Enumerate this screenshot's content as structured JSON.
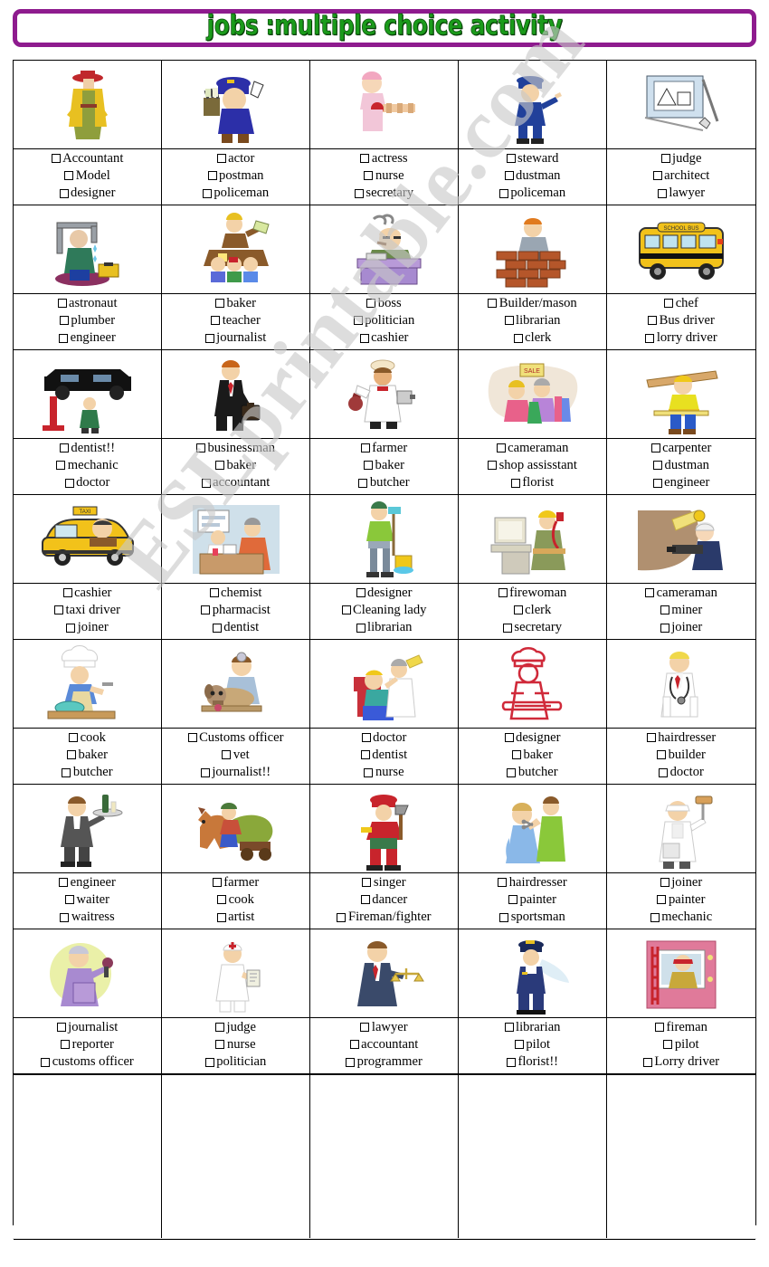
{
  "header": {
    "title": "jobs :multiple choice activity",
    "title_color": "#1b9b1b",
    "border_color": "#8e1b8e"
  },
  "watermark": {
    "text": "ESLprintable.com",
    "color": "#c9c9c9"
  },
  "grid": {
    "columns": 5,
    "rows": 8,
    "checkbox_glyph": "checkbox-empty",
    "cells": [
      {
        "image": "woman-model-yellow-coat-red-hat",
        "options": [
          "Accountant",
          "Model",
          "designer"
        ]
      },
      {
        "image": "postman-blue-uniform-mailbag",
        "options": [
          "actor",
          "postman",
          "policeman"
        ]
      },
      {
        "image": "nurse-pink-cap-with-bandaged-leg",
        "options": [
          "actress",
          "nurse",
          "secretary"
        ]
      },
      {
        "image": "policeman-blue-uniform-pointing",
        "options": [
          "steward",
          "dustman",
          "policeman"
        ]
      },
      {
        "image": "architect-drawing-board-blueprint",
        "options": [
          "judge",
          "architect",
          "lawyer"
        ]
      },
      {
        "image": "plumber-fixing-leaking-pipe-toolbox",
        "options": [
          "astronaut",
          "plumber",
          "engineer"
        ]
      },
      {
        "image": "teacher-with-children-at-desk",
        "options": [
          "baker",
          "teacher",
          "journalist"
        ]
      },
      {
        "image": "boss-at-desk-smoking-cigar",
        "options": [
          "boss",
          "politician",
          "cashier"
        ]
      },
      {
        "image": "builder-laying-brick-wall",
        "options": [
          "Builder/mason",
          "librarian",
          "clerk"
        ]
      },
      {
        "image": "yellow-school-bus",
        "options": [
          "chef",
          "Bus driver",
          "lorry driver"
        ]
      },
      {
        "image": "mechanic-under-car-on-lift",
        "options": [
          "dentist!!",
          "mechanic",
          "doctor"
        ]
      },
      {
        "image": "businessman-black-suit-briefcase",
        "options": [
          "businessman",
          "baker",
          "accountant"
        ]
      },
      {
        "image": "butcher-holding-meat-and-cleaver",
        "options": [
          "farmer",
          "baker",
          "butcher"
        ]
      },
      {
        "image": "shop-assistant-with-customer-sale-sign",
        "options": [
          "cameraman",
          "shop assisstant",
          "florist"
        ]
      },
      {
        "image": "carpenter-carrying-wooden-plank",
        "options": [
          "carpenter",
          "dustman",
          "engineer"
        ]
      },
      {
        "image": "yellow-taxi-with-driver",
        "options": [
          "cashier",
          "taxi driver",
          "joiner"
        ]
      },
      {
        "image": "pharmacist-behind-counter-with-customer",
        "options": [
          "chemist",
          "pharmacist",
          "dentist"
        ]
      },
      {
        "image": "cleaning-lady-with-mop-and-bucket",
        "options": [
          "designer",
          "Cleaning lady",
          "librarian"
        ]
      },
      {
        "image": "secretary-at-computer-on-phone",
        "options": [
          "firewoman",
          "clerk",
          "secretary"
        ]
      },
      {
        "image": "miner-with-jackhammer-in-tunnel",
        "options": [
          "cameraman",
          "miner",
          "joiner"
        ]
      },
      {
        "image": "cook-with-chef-hat-mixing-bowl",
        "options": [
          "cook",
          "baker",
          "butcher"
        ]
      },
      {
        "image": "vet-with-dog-on-table",
        "options": [
          "Customs officer",
          "vet",
          "journalist!!"
        ]
      },
      {
        "image": "dentist-treating-patient-in-chair",
        "options": [
          "doctor",
          "dentist",
          "nurse"
        ]
      },
      {
        "image": "baker-in-red-holding-bread-tray",
        "options": [
          "designer",
          "baker",
          "butcher"
        ]
      },
      {
        "image": "doctor-white-coat-stethoscope",
        "options": [
          "hairdresser",
          "builder",
          "doctor"
        ]
      },
      {
        "image": "waiter-carrying-tray-with-bottle",
        "options": [
          "engineer",
          "waiter",
          "waitress"
        ]
      },
      {
        "image": "farmer-with-horse-and-hay-cart",
        "options": [
          "farmer",
          "cook",
          "artist"
        ]
      },
      {
        "image": "fireman-red-uniform-with-axe",
        "options": [
          "singer",
          "dancer",
          "Fireman/fighter"
        ]
      },
      {
        "image": "hairdresser-cutting-womans-hair",
        "options": [
          "hairdresser",
          "painter",
          "sportsman"
        ]
      },
      {
        "image": "painter-in-white-overalls-with-roller",
        "options": [
          "joiner",
          "painter",
          "mechanic"
        ]
      },
      {
        "image": "journalist-woman-with-microphone",
        "options": [
          "journalist",
          "reporter",
          "customs officer"
        ]
      },
      {
        "image": "nurse-white-uniform-with-clipboard",
        "options": [
          "judge",
          "nurse",
          "politician"
        ]
      },
      {
        "image": "lawyer-in-suit-holding-scales",
        "options": [
          "lawyer",
          "accountant",
          "programmer"
        ]
      },
      {
        "image": "pilot-in-uniform-with-plane",
        "options": [
          "librarian",
          "pilot",
          "florist!!"
        ]
      },
      {
        "image": "fireman-at-window-with-ladder",
        "options": [
          "fireman",
          "pilot",
          "Lorry driver"
        ]
      }
    ],
    "last_row_empty": true
  }
}
